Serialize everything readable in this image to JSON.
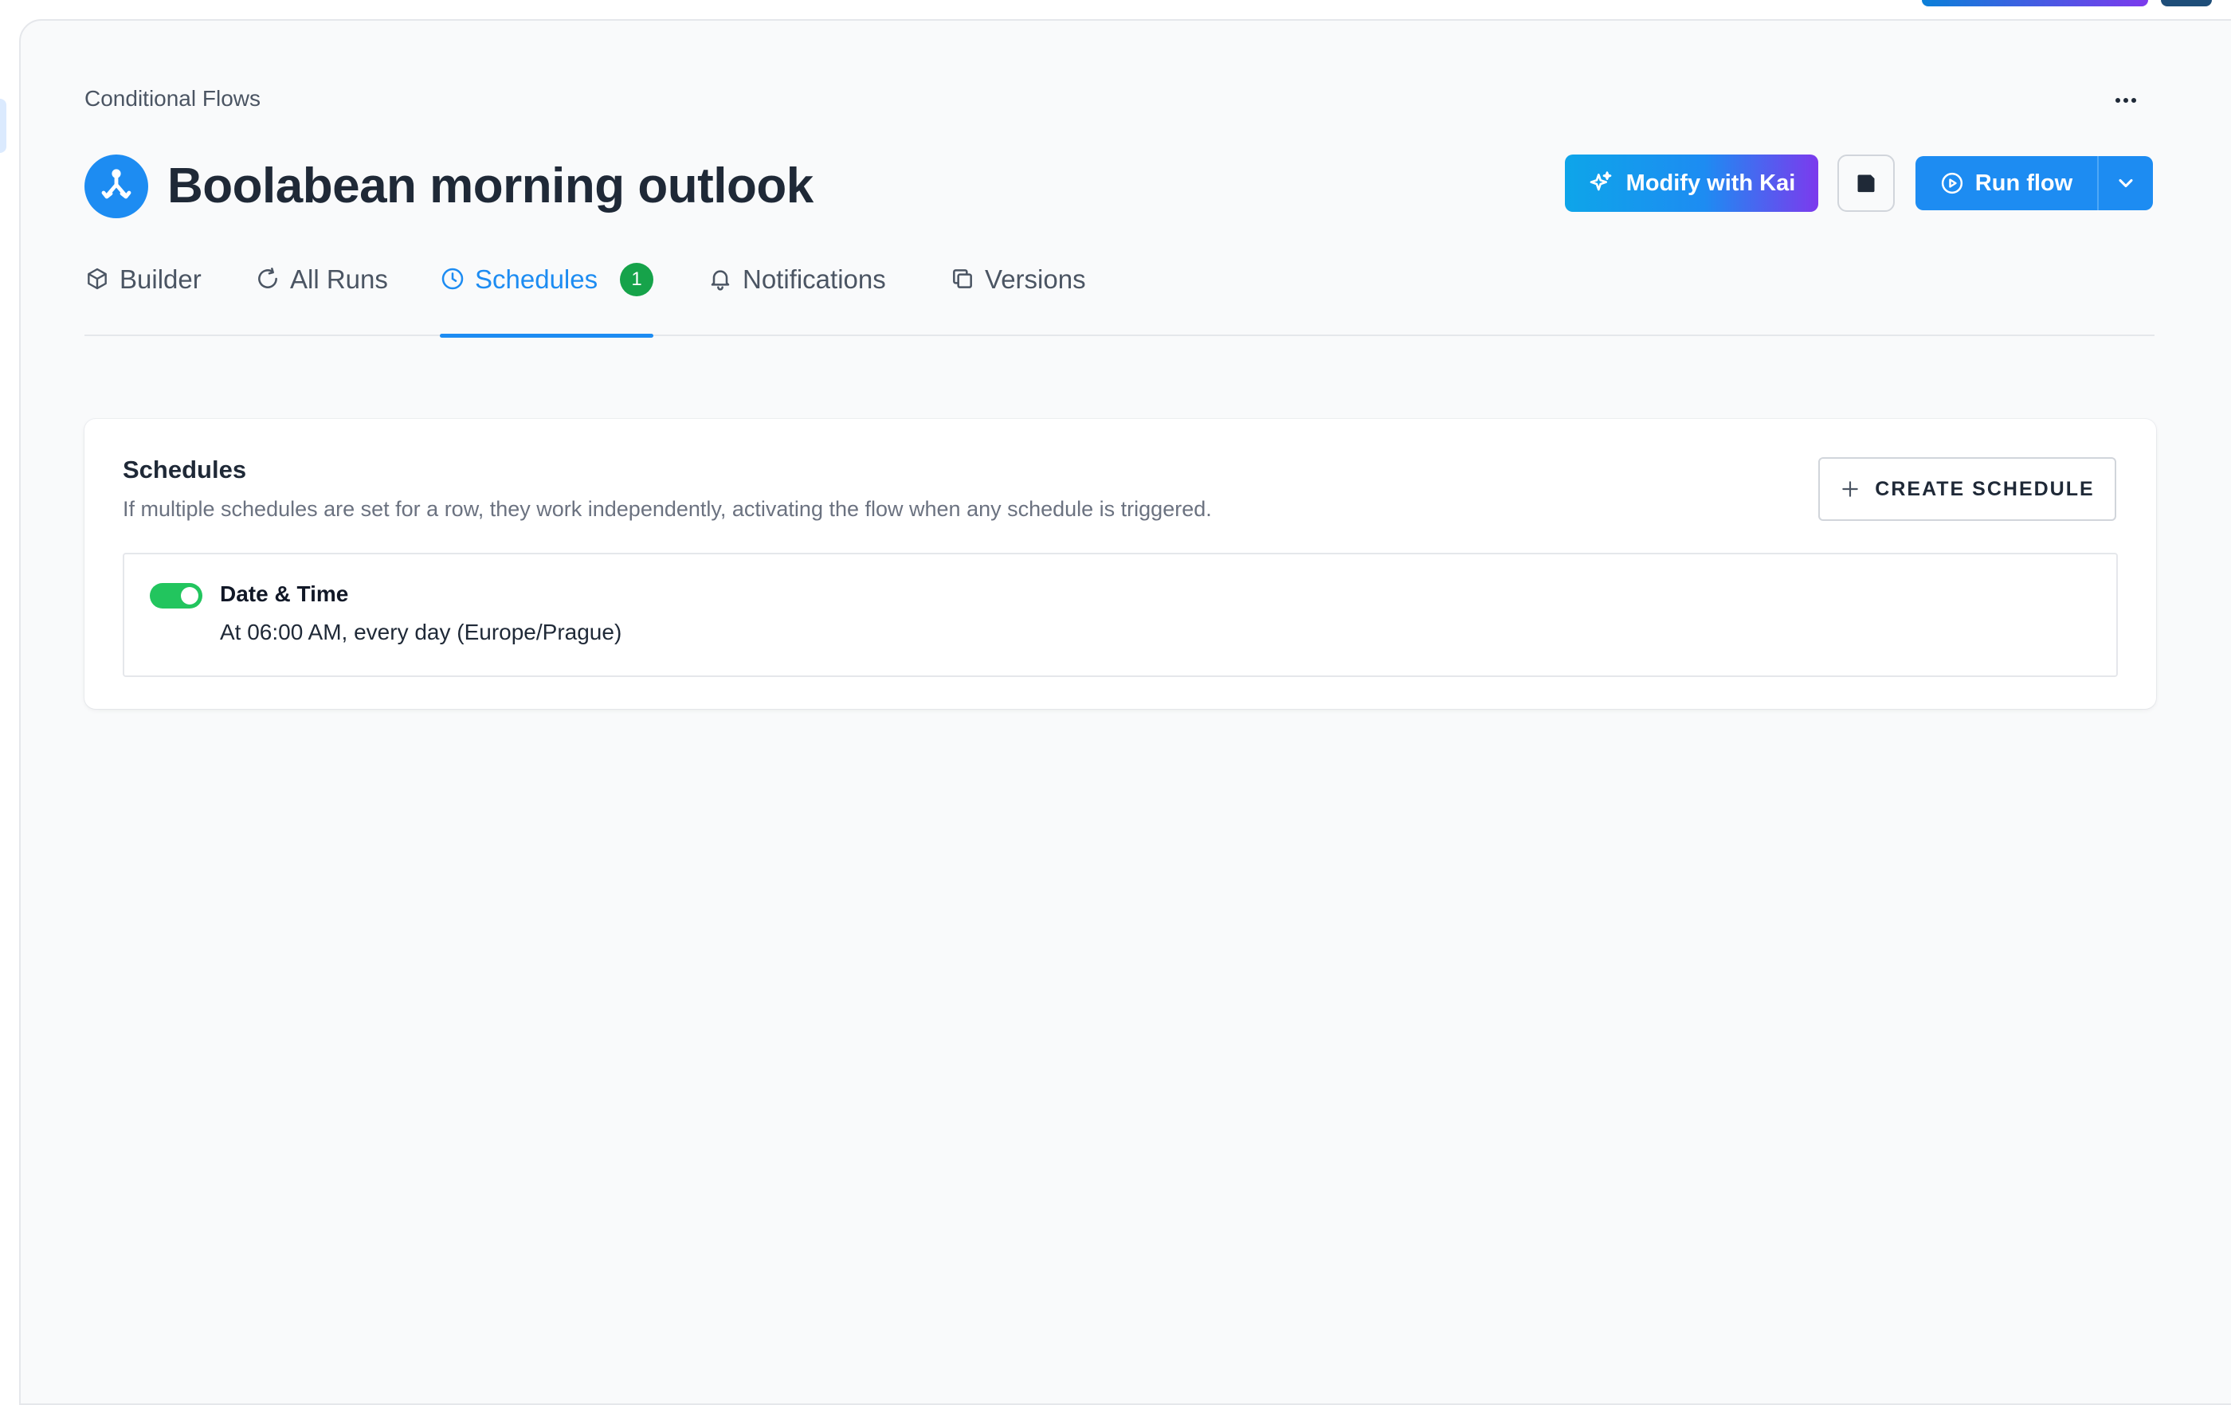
{
  "breadcrumb": "Conditional Flows",
  "header": {
    "title": "Boolabean morning outlook",
    "kai_label": "Modify with Kai",
    "run_label": "Run flow"
  },
  "tabs": [
    {
      "label": "Builder",
      "icon": "cube-icon"
    },
    {
      "label": "All Runs",
      "icon": "refresh-icon"
    },
    {
      "label": "Schedules",
      "icon": "clock-icon",
      "badge": "1",
      "active": true
    },
    {
      "label": "Notifications",
      "icon": "bell-icon"
    },
    {
      "label": "Versions",
      "icon": "copy-icon"
    }
  ],
  "schedules": {
    "title": "Schedules",
    "description": "If multiple schedules are set for a row, they work independently, activating the flow when any schedule is triggered.",
    "create_label": "CREATE SCHEDULE",
    "items": [
      {
        "name": "Date & Time",
        "detail": "At 06:00 AM, every day (Europe/Prague)",
        "enabled": true
      }
    ]
  },
  "colors": {
    "accent": "#1d8cf2",
    "success": "#22c55e",
    "badge": "#16a34a"
  }
}
